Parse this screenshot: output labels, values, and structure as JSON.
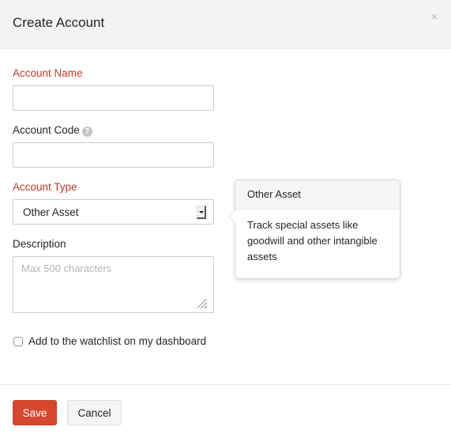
{
  "header": {
    "title": "Create Account",
    "close_icon": "×"
  },
  "form": {
    "account_name": {
      "label": "Account Name",
      "value": "",
      "required": true
    },
    "account_code": {
      "label": "Account Code",
      "value": "",
      "help_icon": "?"
    },
    "account_type": {
      "label": "Account Type",
      "selected": "Other Asset",
      "required": true
    },
    "description": {
      "label": "Description",
      "value": "",
      "placeholder": "Max 500 characters"
    },
    "watchlist": {
      "label": "Add to the watchlist on my dashboard",
      "checked": false
    }
  },
  "popover": {
    "title": "Other Asset",
    "body": "Track special assets like goodwill and other intangible assets"
  },
  "footer": {
    "save_label": "Save",
    "cancel_label": "Cancel"
  },
  "colors": {
    "required_label": "#c0392b",
    "primary_button": "#d6472f",
    "header_bg": "#f4f4f4"
  }
}
